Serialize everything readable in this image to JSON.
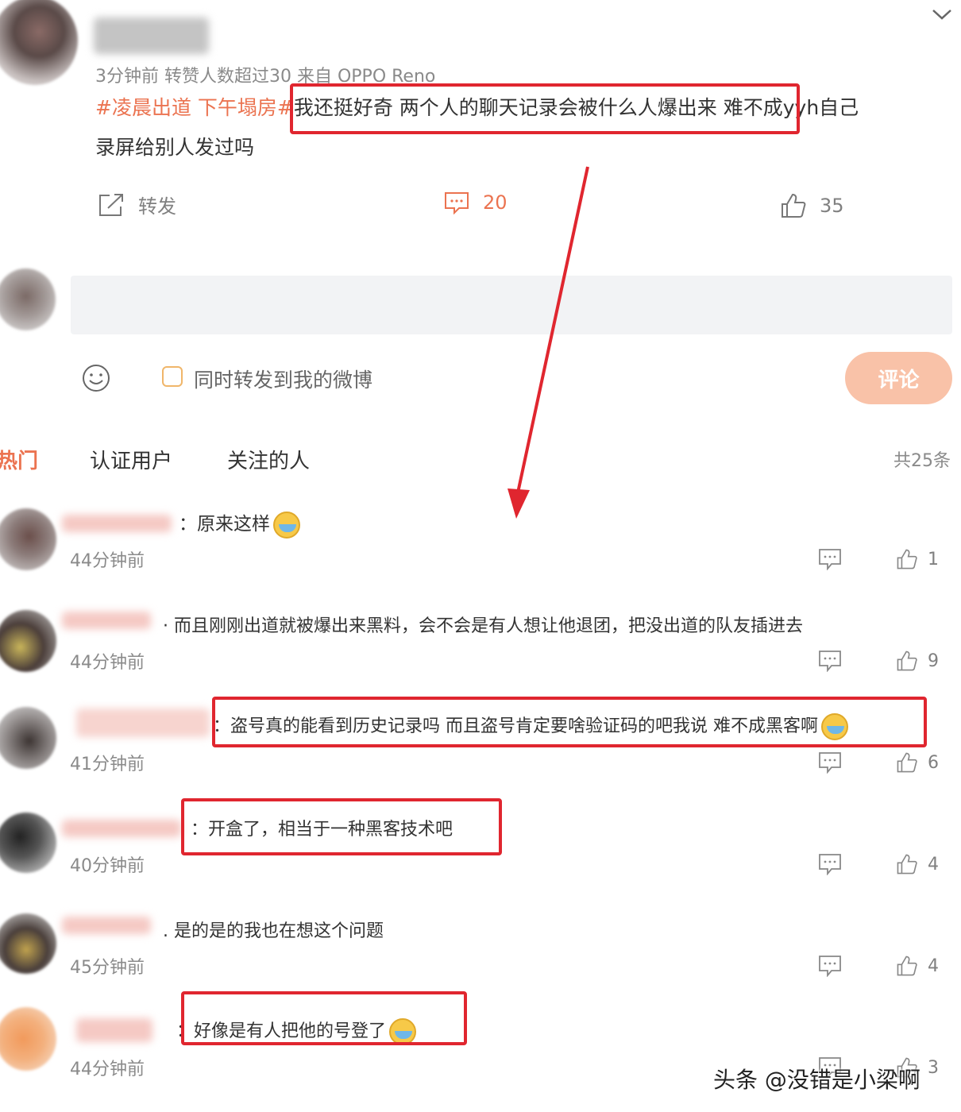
{
  "post": {
    "meta": "3分钟前 转赞人数超过30  来自 OPPO Reno",
    "hashtag": "#凌晨出道 下午塌房#",
    "text_line1": "我还挺好奇 两个人的聊天记录会被什么人爆出来 难不成yyh自己",
    "text_line2": "录屏给别人发过吗",
    "actions": {
      "repost_label": "转发",
      "comment_count": "20",
      "like_count": "35"
    }
  },
  "composer": {
    "checkbox_label": "同时转发到我的微博",
    "submit_label": "评论"
  },
  "tabs": {
    "hot": "热门",
    "verified": "认证用户",
    "following": "关注的人",
    "total": "共25条"
  },
  "comments": [
    {
      "text": "：原来这样",
      "time": "44分钟前",
      "likes": "1",
      "emoji": true
    },
    {
      "text": "· 而且刚刚出道就被爆出来黑料，会不会是有人想让他退团，把没出道的队友插进去",
      "time": "44分钟前",
      "likes": "9",
      "emoji": false
    },
    {
      "text": "：盗号真的能看到历史记录吗 而且盗号肯定要啥验证码的吧我说 难不成黑客啊",
      "time": "41分钟前",
      "likes": "6",
      "emoji": true
    },
    {
      "text": "：开盒了，相当于一种黑客技术吧",
      "time": "40分钟前",
      "likes": "4",
      "emoji": false
    },
    {
      "text": ". 是的是的我也在想这个问题",
      "time": "45分钟前",
      "likes": "4",
      "emoji": false
    },
    {
      "text": "：好像是有人把他的号登了",
      "time": "44分钟前",
      "likes": "3",
      "emoji": true
    }
  ],
  "watermark": "头条 @没错是小梁啊",
  "colors": {
    "accent": "#eb7350",
    "annotation": "#e0262f",
    "button": "#f9c2a8"
  }
}
